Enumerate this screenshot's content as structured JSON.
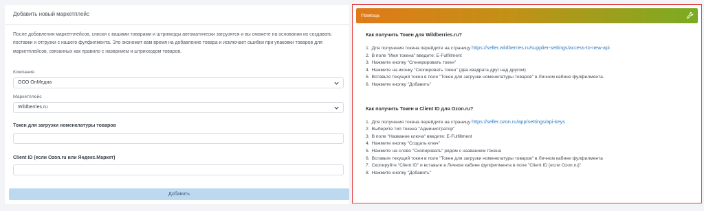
{
  "form": {
    "title": "Добавить новый маркетплейс",
    "description": "После добавления маркетплейсов, списки с вашими товарами и штрихкоды автоматически загрузятся и вы сможете на основании их создавать поставки и отгрузки с нашего фулфилмента. Это экономит вам время на добавление товара и исключает ошибки при упаковки товаров для маркетплейсов, связанных как правило с названием и штрихкодом товаров.",
    "company_label": "Компания",
    "company_value": "ООО ОнМедиа",
    "marketplace_label": "Маркетплейс",
    "marketplace_value": "Wildberries.ru",
    "token_label": "Токен для загрузки номенклатуры товаров",
    "token_value": "",
    "client_id_label": "Client ID (если Ozon.ru или Яндекс.Маркет)",
    "client_id_value": "",
    "submit_label": "Добавить"
  },
  "help": {
    "title": "Помощь",
    "wb": {
      "question": "Как получить Токен для Wildberries.ru?",
      "steps": [
        {
          "n": "1.",
          "text": "Для получения токена перейдите на страницу ",
          "link": "https://seller.wildberries.ru/supplier-settings/access-to-new-api"
        },
        {
          "n": "2.",
          "text": "В поле \"Имя токена\" введите: E-Fulfillment"
        },
        {
          "n": "3.",
          "text": "Нажмите кнопку \"Сгенерировать токен\""
        },
        {
          "n": "4.",
          "text": "Нажмите на иконку \"Скопировать токен\" (два квадрата друг над другом)"
        },
        {
          "n": "5.",
          "text": "Вставьте текущий токен в поле \"Токен для загрузки номенклатуры товаров\" в Личном кабине фулфилмента."
        },
        {
          "n": "6.",
          "text": "Нажмите кнопку \"Добавить\""
        }
      ]
    },
    "ozon": {
      "question": "Как получить Токен и Client ID для Ozon.ru?",
      "steps": [
        {
          "n": "1.",
          "text": "Для получения токена перейдите на страницу ",
          "link": "https://seller.ozon.ru/app/settings/api-keys"
        },
        {
          "n": "2.",
          "text": "Выберите тип токена \"Администратор\""
        },
        {
          "n": "3.",
          "text": "В поле \"Название ключа\" введите: E-Fulfillment"
        },
        {
          "n": "4.",
          "text": "Нажмите кнопку \"Создать ключ\""
        },
        {
          "n": "5.",
          "text": "Нажмите на слово \"Скопировать\" рядом с названием токена"
        },
        {
          "n": "6.",
          "text": "Вставьте текущий токен в поле \"Токен для загрузки номенклатуры товаров\" в Личном кабине фулфилмента"
        },
        {
          "n": "7.",
          "text": "Скопируйте \"Client ID\" и вставьте в Личном кабине фулфилмента в поле \"Client ID (если Ozon.ru)\""
        },
        {
          "n": "8.",
          "text": "Нажмите кнопку \"Добавить\""
        }
      ]
    }
  },
  "colors": {
    "highlight_border": "#e23b3b",
    "header_gradient_start": "#e07a18",
    "header_gradient_end": "#7bab22",
    "link": "#2b79c2",
    "submit_bg": "#bcd9f0"
  },
  "icons": {
    "select_arrow": "chevron-down-icon",
    "help_header": "wrench-icon"
  }
}
